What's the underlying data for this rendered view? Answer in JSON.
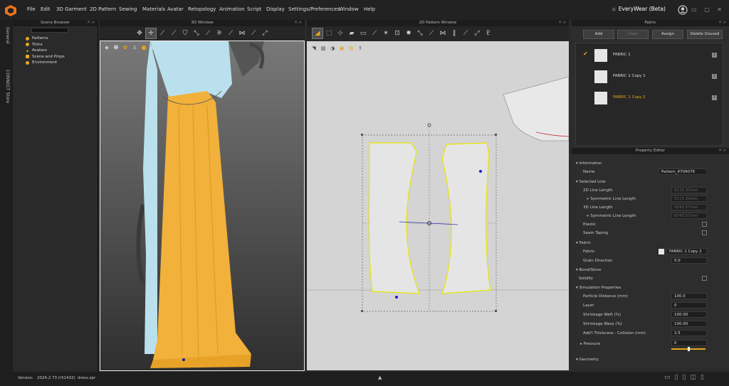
{
  "app": {
    "brand": "EveryWear (Beta)"
  },
  "menu": [
    "File",
    "Edit",
    "3D Garment",
    "2D Pattern",
    "Sewing",
    "Materials",
    "Avatar",
    "Retopology",
    "Animation",
    "Script",
    "Display",
    "Settings/Preferences",
    "Window",
    "Help"
  ],
  "left_tabs": {
    "general": "General",
    "store": "CONNECT Store"
  },
  "scene_browser": {
    "title": "Scene Browser",
    "items": [
      "Patterns",
      "Trims",
      "Avatars",
      "Scene and Props",
      "Environment"
    ]
  },
  "window3d": {
    "title": "3D Window"
  },
  "window2d": {
    "title": "2D Pattern Window"
  },
  "fabric": {
    "title": "Fabric",
    "buttons": {
      "add": "Add",
      "copy": "Copy",
      "assign": "Assign",
      "delete": "Delete Unused"
    },
    "list": [
      "FABRIC 1",
      "FABRIC 1 Copy 1",
      "FABRIC 1 Copy 2"
    ],
    "selected_color": "#e8a71b"
  },
  "property_editor": {
    "title": "Property Editor",
    "information": "Information",
    "name_label": "Name",
    "name_value": "Pattern_4709076",
    "selected_line": "Selected Line",
    "line2d": "2D Line Length",
    "line2d_v": "6115.33mm",
    "sym1": "+ Symmetric Line Length",
    "sym1_v": "6115.33mm",
    "line3d": "3D Line Length",
    "line3d_v": "6543.57mm",
    "sym2": "+ Symmetric Line Length",
    "sym2_v": "6543.57mm",
    "elastic": "Elastic",
    "seam": "Seam Taping",
    "fabric_sect": "Fabric",
    "fabric_label": "Fabric",
    "fabric_value": "FABRIC 1 Copy 2",
    "grain": "Grain Direction",
    "grain_v": "0.0",
    "bond": "Bond/Skive",
    "solidify": "Solidify",
    "sim": "Simulation Properties",
    "particle": "Particle Distance (mm)",
    "particle_v": "100.0",
    "layer": "Layer",
    "layer_v": "0",
    "weft": "Shrinkage Weft (%)",
    "weft_v": "100.00",
    "warp": "Shrinkage Warp (%)",
    "warp_v": "100.00",
    "thick": "Add'l Thickness - Collision (mm)",
    "thick_v": "2.5",
    "pressure": "Pressure",
    "pressure_v": "0",
    "geometry": "Geometry"
  },
  "status": {
    "version_label": "Version:",
    "version": "2024.2.73 (r51432)",
    "file": "dress.zpr"
  }
}
